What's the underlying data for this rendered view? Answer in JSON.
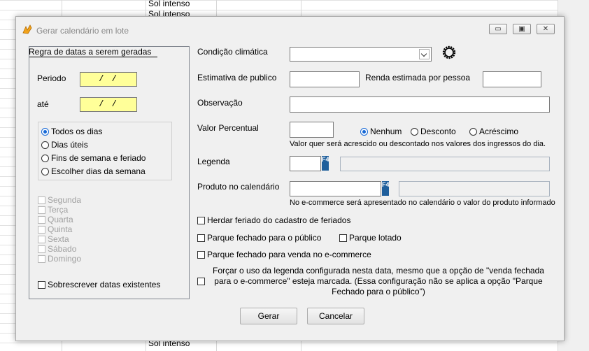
{
  "background": {
    "cell_top_1": "Sol intenso",
    "cell_top_2": "Sol intenso",
    "cell_bottom": "Sol intenso"
  },
  "window": {
    "title": "Gerar calendário em lote",
    "min_glyph": "▭",
    "max_glyph": "▣",
    "close_glyph": "✕"
  },
  "left": {
    "group_title": "Regra de datas a serem geradas",
    "periodo_label": "Periodo",
    "periodo_value": " /  /",
    "ate_label": "até",
    "ate_value": " /  /",
    "day_rules": [
      {
        "label": "Todos os dias",
        "selected": true
      },
      {
        "label": "Dias úteis",
        "selected": false
      },
      {
        "label": "Fins de semana e feriado",
        "selected": false
      },
      {
        "label": "Escolher dias da semana",
        "selected": false
      }
    ],
    "weekdays": [
      "Segunda",
      "Terça",
      "Quarta",
      "Quinta",
      "Sexta",
      "Sábado",
      "Domingo"
    ],
    "overwrite_label": "Sobrescrever datas existentes"
  },
  "form": {
    "condicao_label": "Condição climática",
    "condicao_value": "",
    "publico_label": "Estimativa de publico",
    "publico_value": "",
    "renda_label": "Renda estimada por pessoa",
    "renda_value": "",
    "observacao_label": "Observação",
    "observacao_value": "",
    "percentual_label": "Valor Percentual",
    "percentual_value": "",
    "percentual_options": [
      {
        "label": "Nenhum",
        "selected": true
      },
      {
        "label": "Desconto",
        "selected": false
      },
      {
        "label": "Acréscimo",
        "selected": false
      }
    ],
    "percentual_hint": "Valor quer será acrescido ou descontado nos valores dos ingressos do dia.",
    "legenda_label": "Legenda",
    "f4_key": "F4",
    "produto_label": "Produto no calendário",
    "produto_hint": "No e-commerce será apresentado no calendário o valor do produto informado",
    "herdar_label": "Herdar feriado do cadastro de feriados",
    "fechado_publico_label": "Parque fechado para o público",
    "lotado_label": "Parque lotado",
    "fechado_ecommerce_label": "Parque fechado para venda no e-commerce",
    "forcar_line1": "Forçar o uso da legenda configurada nesta data, mesmo que a opção de \"venda fechada",
    "forcar_line2": "para o e-commerce\" esteja marcada. (Essa configuração não se aplica a opção \"Parque",
    "forcar_line3": "Fechado para o público\")"
  },
  "buttons": {
    "gerar": "Gerar",
    "cancelar": "Cancelar"
  }
}
